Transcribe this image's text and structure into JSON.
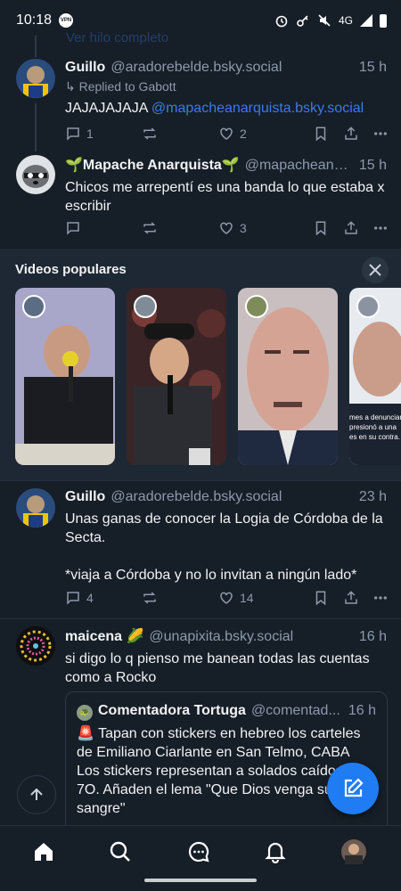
{
  "status_bar": {
    "time": "10:18",
    "vpn": "VPN",
    "network": "4G"
  },
  "faded_link": "Ver hilo completo",
  "posts": [
    {
      "name": "Guillo",
      "handle": "@aradorebelde.bsky.social",
      "time": "15 h",
      "reply_note": "↳ Replied to Gabott",
      "text_plain": "JAJAJAJAJA ",
      "mention": "@mapacheanarquista.bsky.social",
      "replies": "1",
      "reposts": "",
      "likes": "2"
    },
    {
      "name": "🌱Mapache Anarquista🌱",
      "handle": "@mapacheana...",
      "time": "15 h",
      "text": "Chicos me arrepentí es una banda lo que estaba x escribir",
      "replies": "",
      "reposts": "",
      "likes": "3"
    },
    {
      "name": "Guillo",
      "handle": "@aradorebelde.bsky.social",
      "time": "23 h",
      "text": "Unas ganas de conocer la Logia de Córdoba de la Secta.\n\n*viaja a Córdoba y no lo invitan a ningún lado*",
      "replies": "4",
      "reposts": "",
      "likes": "14"
    },
    {
      "name": "maicena 🌽",
      "handle": "@unapixita.bsky.social",
      "time": "16 h",
      "text": "si digo lo q pienso me banean todas las cuentas como a Rocko"
    }
  ],
  "quote": {
    "name": "Comentadora Tortuga",
    "handle": "@comentad...",
    "time": "16 h",
    "text": "🚨 Tapan con stickers en hebreo los carteles de Emiliano Ciarlante en San Telmo, CABA\nLos stickers representan a solados caídos el 7O. Añaden el lema \"Que Dios venga su sangre\""
  },
  "videos": {
    "title": "Videos populares",
    "cards": [
      {
        "caption": ""
      },
      {
        "caption": ""
      },
      {
        "caption": ""
      },
      {
        "caption": "mes a denunciar\npresionó a una\nes en su contra."
      }
    ]
  },
  "colors": {
    "background": "#161e27",
    "accent": "#1f7cf2",
    "link": "#3b7be8",
    "muted": "#8c9aab"
  },
  "icons": [
    "home-icon",
    "search-icon",
    "chat-icon",
    "bell-icon",
    "profile-avatar",
    "compose-icon",
    "arrow-up-icon",
    "close-icon"
  ]
}
